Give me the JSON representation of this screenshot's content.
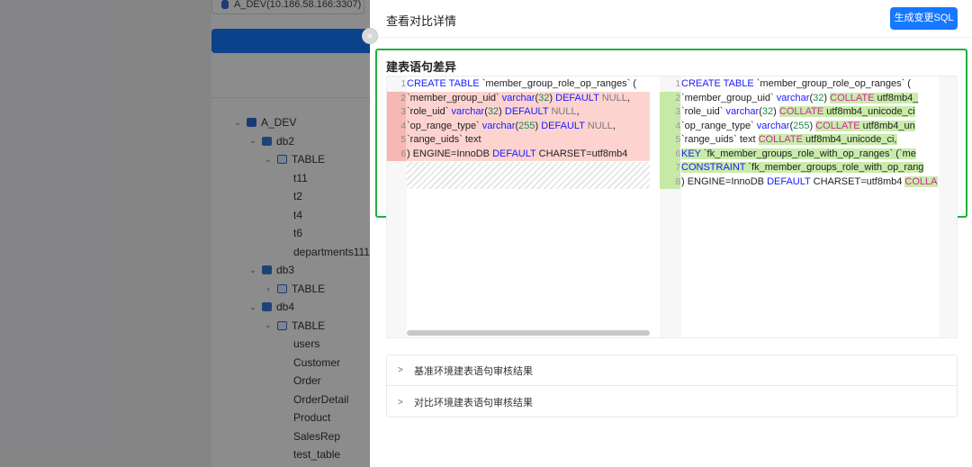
{
  "background": {
    "datasource_label": "A_DEV(10.186.58.166:3307)",
    "tree": [
      {
        "label": "A_DEV",
        "level": 0,
        "expanded": true,
        "icon": "database-icon"
      },
      {
        "label": "db2",
        "level": 1,
        "expanded": true,
        "icon": "schema-icon"
      },
      {
        "label": "TABLE",
        "level": 2,
        "expanded": true,
        "icon": "table-group-icon"
      },
      {
        "label": "t11",
        "level": 3
      },
      {
        "label": "t2",
        "level": 3
      },
      {
        "label": "t4",
        "level": 3
      },
      {
        "label": "t6",
        "level": 3
      },
      {
        "label": "departments11111",
        "level": 3
      },
      {
        "label": "db3",
        "level": 1,
        "expanded": true,
        "icon": "schema-icon"
      },
      {
        "label": "TABLE",
        "level": 2,
        "expanded": false,
        "icon": "table-group-icon"
      },
      {
        "label": "db4",
        "level": 1,
        "expanded": true,
        "icon": "schema-icon"
      },
      {
        "label": "TABLE",
        "level": 2,
        "expanded": true,
        "icon": "table-group-icon"
      },
      {
        "label": "users",
        "level": 3
      },
      {
        "label": "Customer",
        "level": 3
      },
      {
        "label": "Order",
        "level": 3
      },
      {
        "label": "OrderDetail",
        "level": 3
      },
      {
        "label": "Product",
        "level": 3
      },
      {
        "label": "SalesRep",
        "level": 3
      },
      {
        "label": "test_table",
        "level": 3
      }
    ]
  },
  "drawer": {
    "title": "查看对比详情",
    "generate_button": "生成变更SQL",
    "close_icon": "×",
    "diff_heading": "建表语句差异",
    "left_lines": [
      {
        "n": "1",
        "status": "normal",
        "html": "<span class=\"kw\">CREATE</span> <span class=\"kw\">TABLE</span> `member_group_role_op_ranges` ("
      },
      {
        "n": "2",
        "status": "del",
        "html": " `member_group_uid` <span class=\"kw\">varchar</span>(<span class=\"num\">32</span>) <span class=\"kw\">DEFAULT</span> <span class=\"nul\">NULL</span>,"
      },
      {
        "n": "3",
        "status": "del",
        "html": " `role_uid` <span class=\"kw\">varchar</span>(<span class=\"num\">32</span>) <span class=\"kw\">DEFAULT</span> <span class=\"nul\">NULL</span>,"
      },
      {
        "n": "4",
        "status": "del",
        "html": " `op_range_type` <span class=\"kw\">varchar</span>(<span class=\"num\">255</span>) <span class=\"kw\">DEFAULT</span> <span class=\"nul\">NULL</span>,"
      },
      {
        "n": "5",
        "status": "del",
        "html": " `range_uids` text"
      },
      {
        "n": "6",
        "status": "del",
        "html": ") ENGINE=InnoDB <span class=\"kw\">DEFAULT</span> CHARSET=utf8mb4"
      }
    ],
    "right_lines": [
      {
        "n": "1",
        "status": "normal",
        "html": "<span class=\"kw\">CREATE</span> <span class=\"kw\">TABLE</span> `member_group_role_op_ranges` ("
      },
      {
        "n": "2",
        "status": "add",
        "html": " `member_group_uid` <span class=\"kw\">varchar</span>(<span class=\"num\">32</span>) <span class=\"hl-add\"><span class=\"kw2\">COLLATE</span> utf8mb4_</span>"
      },
      {
        "n": "3",
        "status": "add",
        "html": " `role_uid` <span class=\"kw\">varchar</span>(<span class=\"num\">32</span>) <span class=\"hl-add\"><span class=\"kw2\">COLLATE</span> utf8mb4_unicode_ci</span>"
      },
      {
        "n": "4",
        "status": "add",
        "html": " `op_range_type` <span class=\"kw\">varchar</span>(<span class=\"num\">255</span>) <span class=\"hl-add\"><span class=\"kw2\">COLLATE</span> utf8mb4_un</span>"
      },
      {
        "n": "5",
        "status": "add",
        "html": " `range_uids` text <span class=\"hl-add\"><span class=\"kw2\">COLLATE</span> utf8mb4_unicode_ci,</span>"
      },
      {
        "n": "6",
        "status": "add",
        "html": "<span class=\"hl-add\"> <span class=\"kw\">KEY</span> `fk_member_groups_role_with_op_ranges` (`me</span>"
      },
      {
        "n": "7",
        "status": "add",
        "html": "<span class=\"hl-add\"> <span class=\"kw\">CONSTRAINT</span> `fk_member_groups_role_with_op_rang</span>"
      },
      {
        "n": "8",
        "status": "add",
        "html": ") ENGINE=InnoDB <span class=\"kw\">DEFAULT</span> CHARSET=utf8mb4 <span class=\"hl-add\"><span class=\"kw2\">COLLA</span></span>"
      }
    ],
    "collapse_items": [
      {
        "label": "基准环境建表语句审核结果"
      },
      {
        "label": "对比环境建表语句审核结果"
      }
    ],
    "colors": {
      "primary": "#1677ff",
      "highlight_border": "#20b03c",
      "deleted_bg": "#fdd3d0",
      "added_bg": "#c9ecaa"
    }
  }
}
